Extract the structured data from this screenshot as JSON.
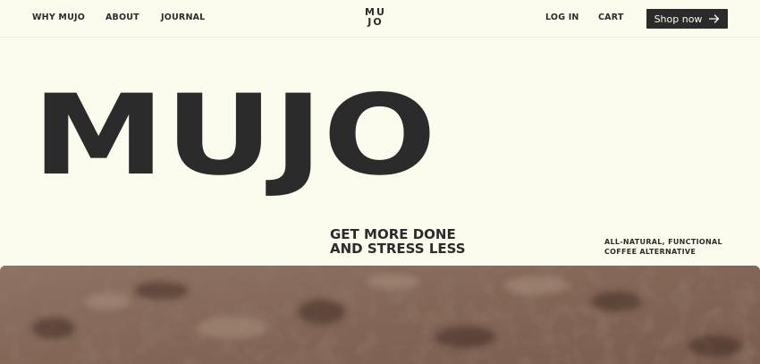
{
  "nav": {
    "left_links": [
      "WHY MUJO",
      "ABOUT",
      "JOURNAL"
    ],
    "logo_line1": "MU",
    "logo_line2": "JO",
    "log_in": "LOG IN",
    "cart": "CART",
    "shop_now": "Shop now",
    "shop_icon": "arrow-right-icon"
  },
  "hero": {
    "title": "MUJO",
    "tagline_line1": "GET MORE DONE",
    "tagline_line2": "AND STRESS LESS",
    "sub_line1": "ALL-NATURAL, FUNCTIONAL",
    "sub_line2": "COFFEE ALTERNATIVE"
  },
  "colors": {
    "background": "#fbfbee",
    "text": "#2b2b2b",
    "button_bg": "#2b2b2b",
    "button_text": "#fbfbee",
    "photo_tone": "#8a6f60"
  }
}
